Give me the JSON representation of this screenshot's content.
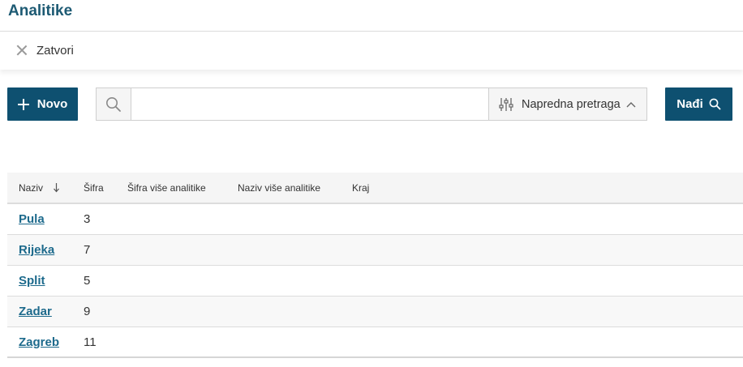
{
  "header": {
    "title": "Analitike",
    "close_label": "Zatvori"
  },
  "toolbar": {
    "new_label": "Novo",
    "search_value": "",
    "search_placeholder": "",
    "advanced_label": "Napredna pretraga",
    "find_label": "Nađi"
  },
  "table": {
    "columns": [
      "Naziv",
      "Šifra",
      "Šifra više analitike",
      "Naziv više analitike",
      "Kraj"
    ],
    "rows": [
      {
        "name": "Pula",
        "code": "3"
      },
      {
        "name": "Rijeka",
        "code": "7"
      },
      {
        "name": "Split",
        "code": "5"
      },
      {
        "name": "Zadar",
        "code": "9"
      },
      {
        "name": "Zagreb",
        "code": "11"
      }
    ]
  },
  "colors": {
    "accent": "#0e5070",
    "title": "#1d5a73",
    "link": "#1d6a8c"
  },
  "icons": [
    "close-icon",
    "plus-icon",
    "search-icon",
    "sliders-icon",
    "chevron-up-icon",
    "sort-down-arrow-icon"
  ]
}
